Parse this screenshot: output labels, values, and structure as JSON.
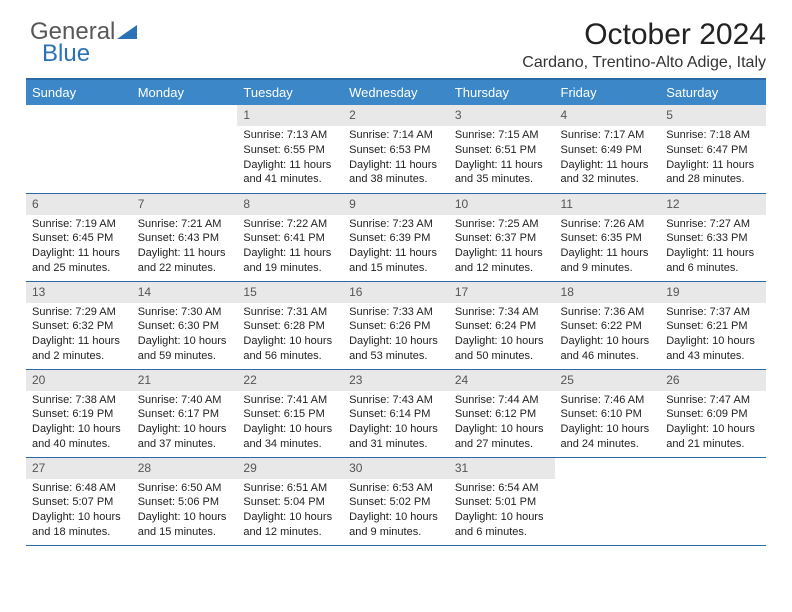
{
  "logo": {
    "part1": "General",
    "part2": "Blue"
  },
  "header": {
    "title": "October 2024",
    "location": "Cardano, Trentino-Alto Adige, Italy"
  },
  "weekdays": [
    "Sunday",
    "Monday",
    "Tuesday",
    "Wednesday",
    "Thursday",
    "Friday",
    "Saturday"
  ],
  "weeks": [
    [
      {
        "empty": true
      },
      {
        "empty": true
      },
      {
        "num": "1",
        "sunrise": "Sunrise: 7:13 AM",
        "sunset": "Sunset: 6:55 PM",
        "daylight1": "Daylight: 11 hours",
        "daylight2": "and 41 minutes."
      },
      {
        "num": "2",
        "sunrise": "Sunrise: 7:14 AM",
        "sunset": "Sunset: 6:53 PM",
        "daylight1": "Daylight: 11 hours",
        "daylight2": "and 38 minutes."
      },
      {
        "num": "3",
        "sunrise": "Sunrise: 7:15 AM",
        "sunset": "Sunset: 6:51 PM",
        "daylight1": "Daylight: 11 hours",
        "daylight2": "and 35 minutes."
      },
      {
        "num": "4",
        "sunrise": "Sunrise: 7:17 AM",
        "sunset": "Sunset: 6:49 PM",
        "daylight1": "Daylight: 11 hours",
        "daylight2": "and 32 minutes."
      },
      {
        "num": "5",
        "sunrise": "Sunrise: 7:18 AM",
        "sunset": "Sunset: 6:47 PM",
        "daylight1": "Daylight: 11 hours",
        "daylight2": "and 28 minutes."
      }
    ],
    [
      {
        "num": "6",
        "sunrise": "Sunrise: 7:19 AM",
        "sunset": "Sunset: 6:45 PM",
        "daylight1": "Daylight: 11 hours",
        "daylight2": "and 25 minutes."
      },
      {
        "num": "7",
        "sunrise": "Sunrise: 7:21 AM",
        "sunset": "Sunset: 6:43 PM",
        "daylight1": "Daylight: 11 hours",
        "daylight2": "and 22 minutes."
      },
      {
        "num": "8",
        "sunrise": "Sunrise: 7:22 AM",
        "sunset": "Sunset: 6:41 PM",
        "daylight1": "Daylight: 11 hours",
        "daylight2": "and 19 minutes."
      },
      {
        "num": "9",
        "sunrise": "Sunrise: 7:23 AM",
        "sunset": "Sunset: 6:39 PM",
        "daylight1": "Daylight: 11 hours",
        "daylight2": "and 15 minutes."
      },
      {
        "num": "10",
        "sunrise": "Sunrise: 7:25 AM",
        "sunset": "Sunset: 6:37 PM",
        "daylight1": "Daylight: 11 hours",
        "daylight2": "and 12 minutes."
      },
      {
        "num": "11",
        "sunrise": "Sunrise: 7:26 AM",
        "sunset": "Sunset: 6:35 PM",
        "daylight1": "Daylight: 11 hours",
        "daylight2": "and 9 minutes."
      },
      {
        "num": "12",
        "sunrise": "Sunrise: 7:27 AM",
        "sunset": "Sunset: 6:33 PM",
        "daylight1": "Daylight: 11 hours",
        "daylight2": "and 6 minutes."
      }
    ],
    [
      {
        "num": "13",
        "sunrise": "Sunrise: 7:29 AM",
        "sunset": "Sunset: 6:32 PM",
        "daylight1": "Daylight: 11 hours",
        "daylight2": "and 2 minutes."
      },
      {
        "num": "14",
        "sunrise": "Sunrise: 7:30 AM",
        "sunset": "Sunset: 6:30 PM",
        "daylight1": "Daylight: 10 hours",
        "daylight2": "and 59 minutes."
      },
      {
        "num": "15",
        "sunrise": "Sunrise: 7:31 AM",
        "sunset": "Sunset: 6:28 PM",
        "daylight1": "Daylight: 10 hours",
        "daylight2": "and 56 minutes."
      },
      {
        "num": "16",
        "sunrise": "Sunrise: 7:33 AM",
        "sunset": "Sunset: 6:26 PM",
        "daylight1": "Daylight: 10 hours",
        "daylight2": "and 53 minutes."
      },
      {
        "num": "17",
        "sunrise": "Sunrise: 7:34 AM",
        "sunset": "Sunset: 6:24 PM",
        "daylight1": "Daylight: 10 hours",
        "daylight2": "and 50 minutes."
      },
      {
        "num": "18",
        "sunrise": "Sunrise: 7:36 AM",
        "sunset": "Sunset: 6:22 PM",
        "daylight1": "Daylight: 10 hours",
        "daylight2": "and 46 minutes."
      },
      {
        "num": "19",
        "sunrise": "Sunrise: 7:37 AM",
        "sunset": "Sunset: 6:21 PM",
        "daylight1": "Daylight: 10 hours",
        "daylight2": "and 43 minutes."
      }
    ],
    [
      {
        "num": "20",
        "sunrise": "Sunrise: 7:38 AM",
        "sunset": "Sunset: 6:19 PM",
        "daylight1": "Daylight: 10 hours",
        "daylight2": "and 40 minutes."
      },
      {
        "num": "21",
        "sunrise": "Sunrise: 7:40 AM",
        "sunset": "Sunset: 6:17 PM",
        "daylight1": "Daylight: 10 hours",
        "daylight2": "and 37 minutes."
      },
      {
        "num": "22",
        "sunrise": "Sunrise: 7:41 AM",
        "sunset": "Sunset: 6:15 PM",
        "daylight1": "Daylight: 10 hours",
        "daylight2": "and 34 minutes."
      },
      {
        "num": "23",
        "sunrise": "Sunrise: 7:43 AM",
        "sunset": "Sunset: 6:14 PM",
        "daylight1": "Daylight: 10 hours",
        "daylight2": "and 31 minutes."
      },
      {
        "num": "24",
        "sunrise": "Sunrise: 7:44 AM",
        "sunset": "Sunset: 6:12 PM",
        "daylight1": "Daylight: 10 hours",
        "daylight2": "and 27 minutes."
      },
      {
        "num": "25",
        "sunrise": "Sunrise: 7:46 AM",
        "sunset": "Sunset: 6:10 PM",
        "daylight1": "Daylight: 10 hours",
        "daylight2": "and 24 minutes."
      },
      {
        "num": "26",
        "sunrise": "Sunrise: 7:47 AM",
        "sunset": "Sunset: 6:09 PM",
        "daylight1": "Daylight: 10 hours",
        "daylight2": "and 21 minutes."
      }
    ],
    [
      {
        "num": "27",
        "sunrise": "Sunrise: 6:48 AM",
        "sunset": "Sunset: 5:07 PM",
        "daylight1": "Daylight: 10 hours",
        "daylight2": "and 18 minutes."
      },
      {
        "num": "28",
        "sunrise": "Sunrise: 6:50 AM",
        "sunset": "Sunset: 5:06 PM",
        "daylight1": "Daylight: 10 hours",
        "daylight2": "and 15 minutes."
      },
      {
        "num": "29",
        "sunrise": "Sunrise: 6:51 AM",
        "sunset": "Sunset: 5:04 PM",
        "daylight1": "Daylight: 10 hours",
        "daylight2": "and 12 minutes."
      },
      {
        "num": "30",
        "sunrise": "Sunrise: 6:53 AM",
        "sunset": "Sunset: 5:02 PM",
        "daylight1": "Daylight: 10 hours",
        "daylight2": "and 9 minutes."
      },
      {
        "num": "31",
        "sunrise": "Sunrise: 6:54 AM",
        "sunset": "Sunset: 5:01 PM",
        "daylight1": "Daylight: 10 hours",
        "daylight2": "and 6 minutes."
      },
      {
        "empty": true
      },
      {
        "empty": true
      }
    ]
  ]
}
